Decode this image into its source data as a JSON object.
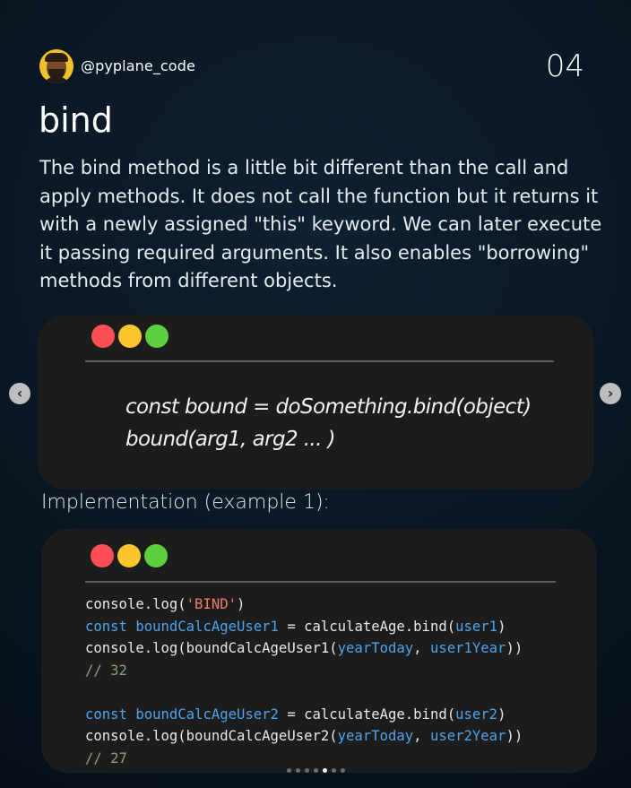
{
  "header": {
    "handle": "@pyplane_code",
    "page_number": "04",
    "avatar_icon": "author-avatar"
  },
  "title": "bind",
  "description": "The bind method is a little bit different than the call and apply methods. It does not call the function but it returns it with a newly assigned \"this\" keyword. We can later execute it passing required arguments. It also enables \"borrowing\" methods from different objects.",
  "syntax_window": {
    "lines": [
      "const bound = doSomething.bind(object)",
      "bound(arg1, arg2 ... )"
    ]
  },
  "section_label": "Implementation (example 1):",
  "example_window": {
    "lines": [
      [
        {
          "t": "console.log(",
          "c": "plain"
        },
        {
          "t": "'BIND'",
          "c": "str"
        },
        {
          "t": ")",
          "c": "plain"
        }
      ],
      [
        {
          "t": "const ",
          "c": "kw"
        },
        {
          "t": "boundCalcAgeUser1",
          "c": "kw"
        },
        {
          "t": " = calculateAge.bind(",
          "c": "plain"
        },
        {
          "t": "user1",
          "c": "arg"
        },
        {
          "t": ")",
          "c": "plain"
        }
      ],
      [
        {
          "t": "console.log(boundCalcAgeUser1(",
          "c": "plain"
        },
        {
          "t": "yearToday",
          "c": "arg"
        },
        {
          "t": ", ",
          "c": "plain"
        },
        {
          "t": "user1Year",
          "c": "arg"
        },
        {
          "t": "))",
          "c": "plain"
        }
      ],
      [
        {
          "t": "// 32",
          "c": "comment"
        }
      ],
      [],
      [
        {
          "t": "const ",
          "c": "kw"
        },
        {
          "t": "boundCalcAgeUser2",
          "c": "kw"
        },
        {
          "t": " = calculateAge.bind(",
          "c": "plain"
        },
        {
          "t": "user2",
          "c": "arg"
        },
        {
          "t": ")",
          "c": "plain"
        }
      ],
      [
        {
          "t": "console.log(boundCalcAgeUser2(",
          "c": "plain"
        },
        {
          "t": "yearToday",
          "c": "arg"
        },
        {
          "t": ", ",
          "c": "plain"
        },
        {
          "t": "user2Year",
          "c": "arg"
        },
        {
          "t": "))",
          "c": "plain"
        }
      ],
      [
        {
          "t": "// 27",
          "c": "comment"
        }
      ]
    ]
  },
  "window_controls": {
    "colors": [
      "#fb4f55",
      "#fcc52d",
      "#5ccf3e"
    ]
  },
  "carousel": {
    "prev_icon": "chevron-left-icon",
    "next_icon": "chevron-right-icon",
    "prev_glyph": "‹",
    "next_glyph": "›",
    "total_slides": 7,
    "active_slide": 5
  }
}
